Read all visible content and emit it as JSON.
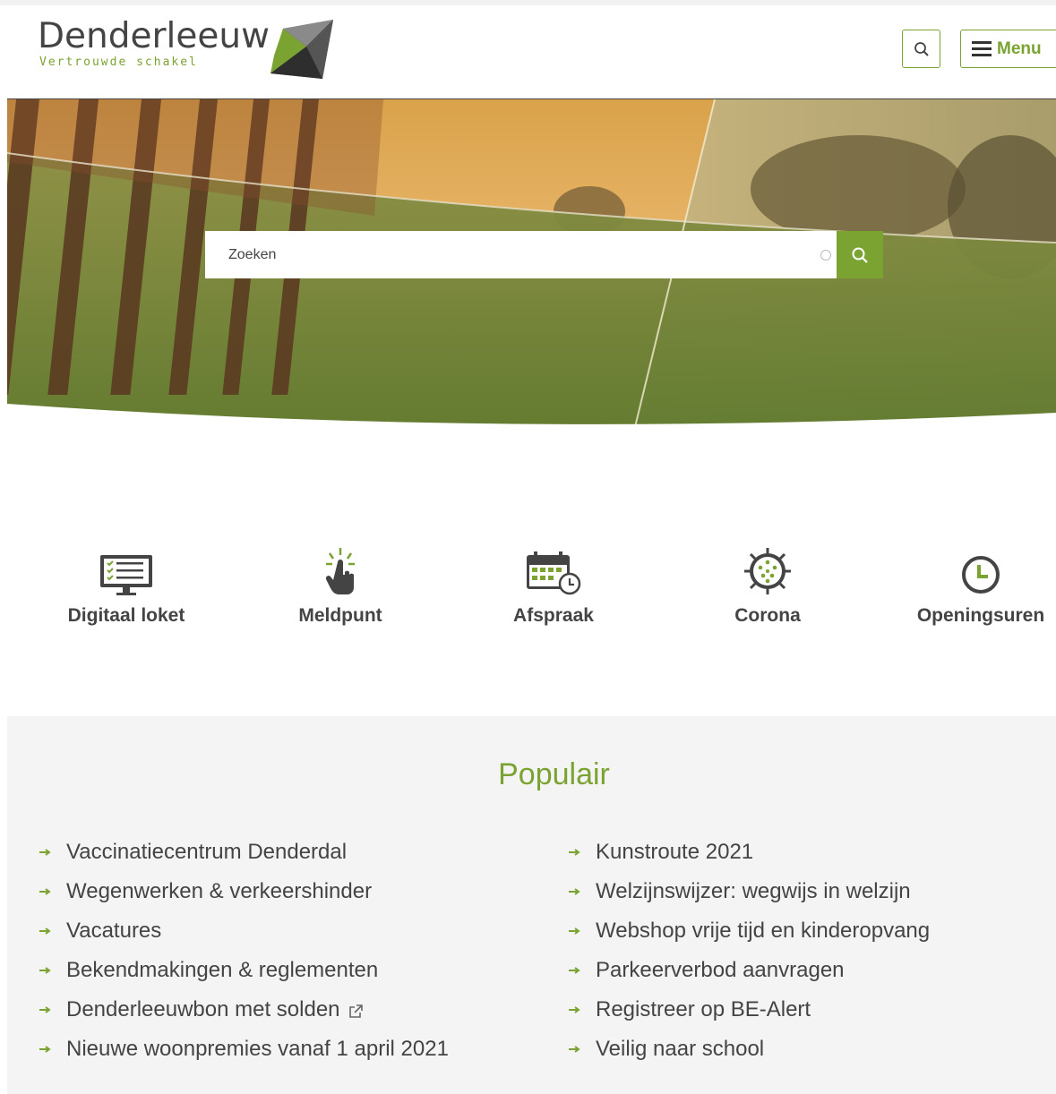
{
  "header": {
    "logo_name": "Denderleeuw",
    "logo_tagline": "Vertrouwde schakel",
    "menu_label": "Menu",
    "icons": {
      "search": "search-icon",
      "menu": "hamburger-icon"
    }
  },
  "hero": {
    "search_placeholder": "Zoeken",
    "icons": {
      "clear": "clear-icon",
      "submit": "search-icon"
    }
  },
  "quick_links": [
    {
      "label": "Digitaal loket",
      "icon": "monitor-checklist-icon"
    },
    {
      "label": "Meldpunt",
      "icon": "hand-pointer-icon"
    },
    {
      "label": "Afspraak",
      "icon": "calendar-clock-icon"
    },
    {
      "label": "Corona",
      "icon": "virus-icon"
    },
    {
      "label": "Openingsuren",
      "icon": "clock-icon"
    }
  ],
  "popular": {
    "title": "Populair",
    "left": [
      {
        "label": "Vaccinatiecentrum Denderdal"
      },
      {
        "label": "Wegenwerken & verkeershinder"
      },
      {
        "label": "Vacatures"
      },
      {
        "label": "Bekendmakingen & reglementen"
      },
      {
        "label": "Denderleeuwbon met solden",
        "external": true
      },
      {
        "label": "Nieuwe woonpremies vanaf 1 april 2021"
      }
    ],
    "right": [
      {
        "label": "Kunstroute 2021"
      },
      {
        "label": "Welzijnswijzer: wegwijs in welzijn"
      },
      {
        "label": "Webshop vrije tijd en kinderopvang"
      },
      {
        "label": "Parkeerverbod aanvragen"
      },
      {
        "label": "Registreer op BE-Alert"
      },
      {
        "label": "Veilig naar school"
      }
    ]
  },
  "colors": {
    "accent": "#7aa332",
    "text": "#444444",
    "popular_bg": "#f4f4f4"
  }
}
